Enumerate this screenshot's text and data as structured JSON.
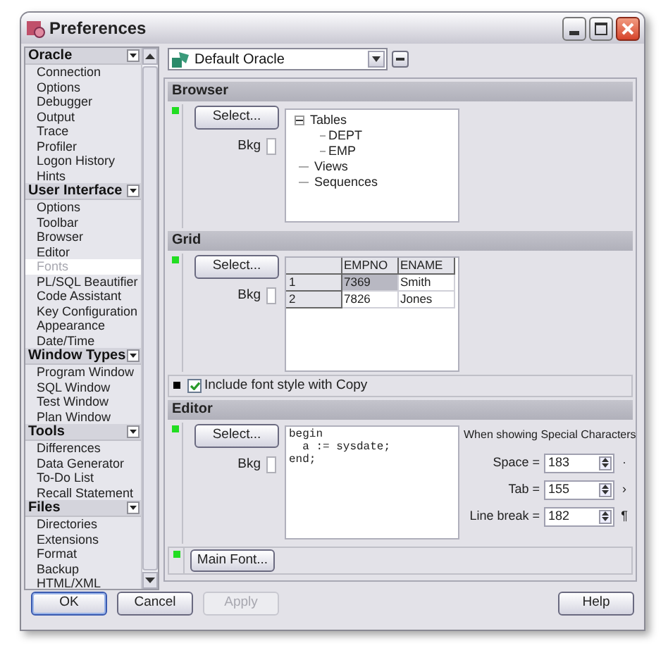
{
  "window": {
    "title": "Preferences"
  },
  "sidebar": {
    "groups": [
      {
        "title": "Oracle",
        "expanded": true,
        "items": [
          {
            "label": "Connection",
            "selected": false
          },
          {
            "label": "Options",
            "selected": false
          },
          {
            "label": "Debugger",
            "selected": false
          },
          {
            "label": "Output",
            "selected": false
          },
          {
            "label": "Trace",
            "selected": false
          },
          {
            "label": "Profiler",
            "selected": false
          },
          {
            "label": "Logon History",
            "selected": false
          },
          {
            "label": "Hints",
            "selected": false
          }
        ]
      },
      {
        "title": "User Interface",
        "expanded": true,
        "items": [
          {
            "label": "Options",
            "selected": false
          },
          {
            "label": "Toolbar",
            "selected": false
          },
          {
            "label": "Browser",
            "selected": false
          },
          {
            "label": "Editor",
            "selected": false
          },
          {
            "label": "Fonts",
            "selected": true
          },
          {
            "label": "PL/SQL Beautifier",
            "selected": false
          },
          {
            "label": "Code Assistant",
            "selected": false
          },
          {
            "label": "Key Configuration",
            "selected": false
          },
          {
            "label": "Appearance",
            "selected": false
          },
          {
            "label": "Date/Time",
            "selected": false
          }
        ]
      },
      {
        "title": "Window Types",
        "expanded": true,
        "items": [
          {
            "label": "Program Window",
            "selected": false
          },
          {
            "label": "SQL Window",
            "selected": false
          },
          {
            "label": "Test Window",
            "selected": false
          },
          {
            "label": "Plan Window",
            "selected": false
          }
        ]
      },
      {
        "title": "Tools",
        "expanded": true,
        "items": [
          {
            "label": "Differences",
            "selected": false
          },
          {
            "label": "Data Generator",
            "selected": false
          },
          {
            "label": "To-Do List",
            "selected": false
          },
          {
            "label": "Recall Statement",
            "selected": false
          }
        ]
      },
      {
        "title": "Files",
        "expanded": true,
        "items": [
          {
            "label": "Directories",
            "selected": false
          },
          {
            "label": "Extensions",
            "selected": false
          },
          {
            "label": "Format",
            "selected": false
          },
          {
            "label": "Backup",
            "selected": false
          },
          {
            "label": "HTML/XML",
            "selected": false
          }
        ]
      }
    ]
  },
  "connection": {
    "value": "Default Oracle"
  },
  "browser": {
    "title": "Browser",
    "color": "#22dd22",
    "select_button": "Select...",
    "bkg_label": "Bkg",
    "tree": [
      {
        "label": "Tables",
        "expanded": true,
        "children": [
          {
            "label": "DEPT"
          },
          {
            "label": "EMP"
          }
        ]
      },
      {
        "label": "Views"
      },
      {
        "label": "Sequences"
      }
    ]
  },
  "grid": {
    "title": "Grid",
    "color": "#22dd22",
    "select_button": "Select...",
    "bkg_label": "Bkg",
    "columns": [
      "EMPNO",
      "ENAME"
    ],
    "rows": [
      {
        "header": "1",
        "cells": [
          {
            "text": "7369",
            "selected": true
          },
          {
            "text": "Smith",
            "selected": false
          }
        ]
      },
      {
        "header": "2",
        "cells": [
          {
            "text": "7826",
            "selected": false
          },
          {
            "text": "Jones",
            "selected": false
          }
        ]
      }
    ]
  },
  "copy_option": {
    "color": "#000000",
    "label": "Include font style with Copy",
    "checked": true
  },
  "editor": {
    "title": "Editor",
    "color": "#22dd22",
    "select_button": "Select...",
    "bkg_label": "Bkg",
    "code": [
      "begin",
      "  a := sysdate;",
      "end;"
    ],
    "special_title": "When showing Special Characters",
    "special": [
      {
        "label": "Space =",
        "value": "183",
        "glyph": "·"
      },
      {
        "label": "Tab =",
        "value": "155",
        "glyph": "›"
      },
      {
        "label": "Line break =",
        "value": "182",
        "glyph": "¶"
      }
    ]
  },
  "main_font": {
    "color": "#22dd22",
    "label": "Main Font..."
  },
  "buttons": [
    {
      "label": "OK",
      "disabled": false,
      "default": true
    },
    {
      "label": "Cancel",
      "disabled": false,
      "default": false
    },
    {
      "label": "Apply",
      "disabled": true,
      "default": false
    }
  ],
  "help_button": {
    "label": "Help"
  }
}
